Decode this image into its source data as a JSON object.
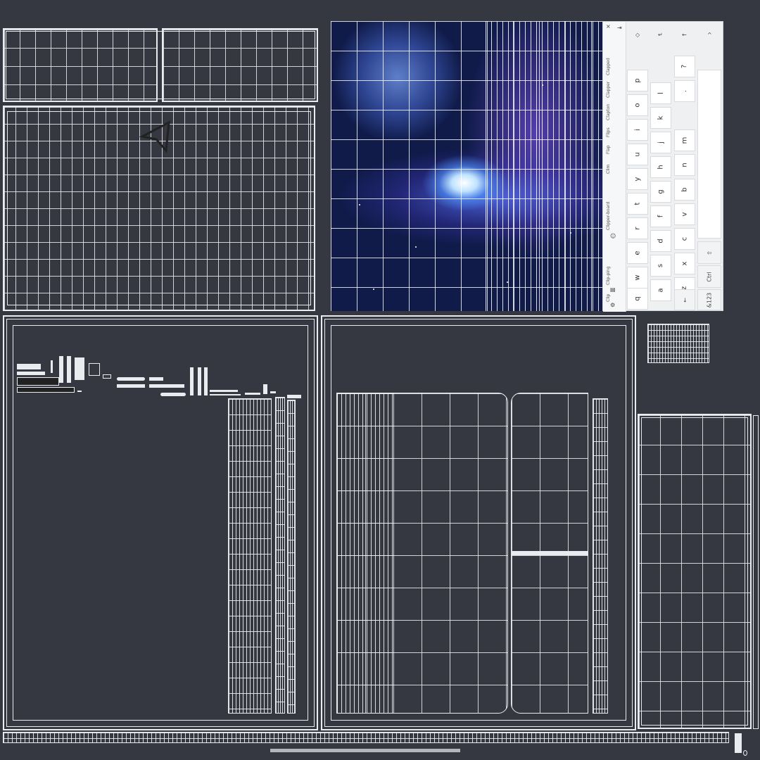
{
  "keyboard": {
    "suggestions": [
      "Clip",
      "Clip-ping",
      "Clipper-board",
      "Clim",
      "Flap",
      "Flips",
      "Clapton",
      "Clapper",
      "Clapped"
    ],
    "row_top": [
      "p",
      "o",
      "i",
      "u",
      "y",
      "t",
      "r",
      "e",
      "w",
      "q"
    ],
    "row_mid": [
      "l",
      "k",
      "j",
      "h",
      "g",
      "f",
      "d",
      "s",
      "a"
    ],
    "row_bot": [
      "m",
      "n",
      "b",
      "v",
      "c",
      "x",
      "z"
    ],
    "punct": [
      "?",
      "."
    ],
    "ctrl_label": "Ctrl",
    "num_label": "&123",
    "icons": {
      "close": "×",
      "dock": "⇥",
      "shield": "◇",
      "enter": "↵",
      "backspace": "←",
      "collapse": "^",
      "shift": "⇧",
      "arrow_left": "←",
      "settings": "⚙",
      "clipboard": "▤",
      "emoji": "☺"
    }
  },
  "icons": {
    "cursor": "arrow-cursor-icon"
  },
  "colors": {
    "background": "#353841",
    "wire": "#e9ecef"
  }
}
